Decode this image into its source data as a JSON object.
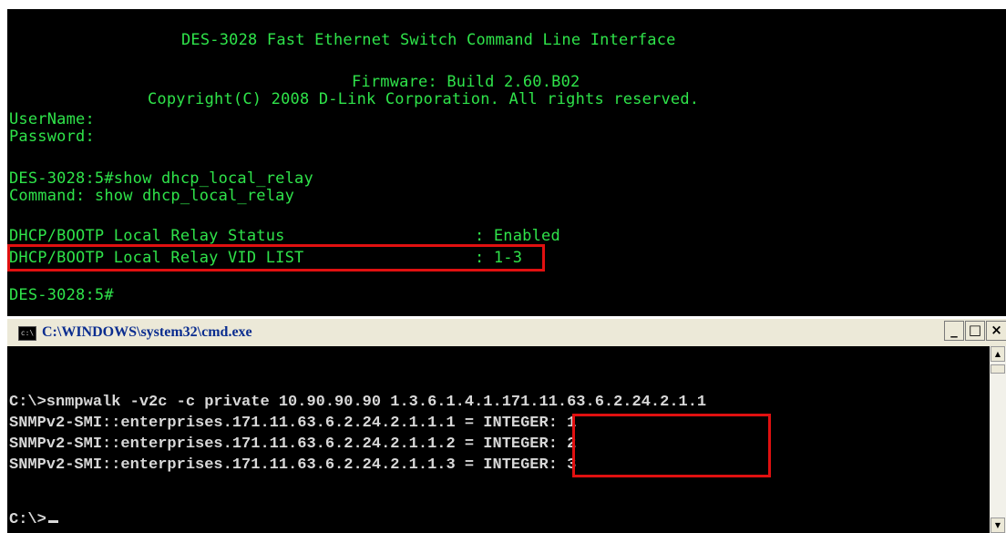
{
  "telnet": {
    "header1": "DES-3028 Fast Ethernet Switch Command Line Interface",
    "header2": "Firmware: Build 2.60.B02",
    "header3": "Copyright(C) 2008 D-Link Corporation. All rights reserved.",
    "username_label": "UserName:",
    "password_label": "Password:",
    "cmd_prompt_line": "DES-3028:5#show dhcp_local_relay",
    "cmd_echo_line": "Command: show dhcp_local_relay",
    "status_label": "DHCP/BOOTP Local Relay Status",
    "status_value": ": Enabled",
    "vid_label": "DHCP/BOOTP Local Relay VID LIST",
    "vid_value": ": 1-3",
    "final_prompt": "DES-3028:5#"
  },
  "cmd_window": {
    "title": "C:\\WINDOWS\\system32\\cmd.exe",
    "sys_icon": "cmd-icon",
    "buttons": {
      "minimize": "_",
      "maximize": "□",
      "close": "×"
    },
    "lines": [
      "C:\\>snmpwalk -v2c -c private 10.90.90.90 1.3.6.1.4.1.171.11.63.6.2.24.2.1.1",
      "SNMPv2-SMI::enterprises.171.11.63.6.2.24.2.1.1.1 = INTEGER: 1",
      "SNMPv2-SMI::enterprises.171.11.63.6.2.24.2.1.1.2 = INTEGER: 2",
      "SNMPv2-SMI::enterprises.171.11.63.6.2.24.2.1.1.3 = INTEGER: 3"
    ],
    "prompt": "C:\\>"
  },
  "colors": {
    "terminal_green": "#2fe34a",
    "console_text": "#d8d8d8",
    "highlight_red": "#e01010",
    "title_text": "#0a2d8f"
  }
}
